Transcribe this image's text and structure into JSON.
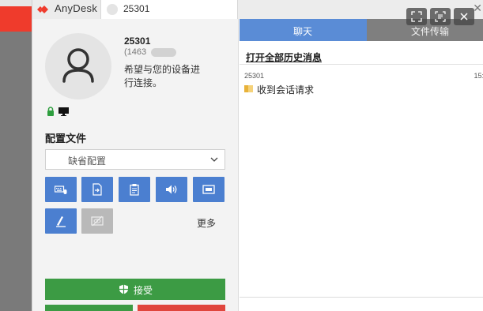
{
  "app": {
    "name": "AnyDesk",
    "brand_color": "#ef3b2c",
    "accent_color": "#4b7fd0"
  },
  "tab": {
    "label": "25301"
  },
  "peer": {
    "id": "25301",
    "alias": "(1463",
    "request_message": "希望与您的设备进行连接。"
  },
  "profile": {
    "title": "配置文件",
    "selected": "缺省配置"
  },
  "toolbar": {
    "buttons": [
      {
        "icon": "keyboard-mouse-icon",
        "enabled": true
      },
      {
        "icon": "file-transfer-icon",
        "enabled": true
      },
      {
        "icon": "clipboard-icon",
        "enabled": true
      },
      {
        "icon": "audio-icon",
        "enabled": true
      },
      {
        "icon": "screen-icon",
        "enabled": true
      },
      {
        "icon": "draw-icon",
        "enabled": true
      },
      {
        "icon": "privacy-screen-icon",
        "enabled": false
      }
    ],
    "more_label": "更多"
  },
  "actions": {
    "accept_label": "接受",
    "accept_color": "#3c9b44",
    "dismiss_color": "#e0463d"
  },
  "chat": {
    "tab_chat": "聊天",
    "tab_files": "文件传输",
    "history_link": "打开全部历史消息",
    "messages": [
      {
        "sender": "25301",
        "time": "15:",
        "text": "收到会话请求"
      }
    ]
  }
}
